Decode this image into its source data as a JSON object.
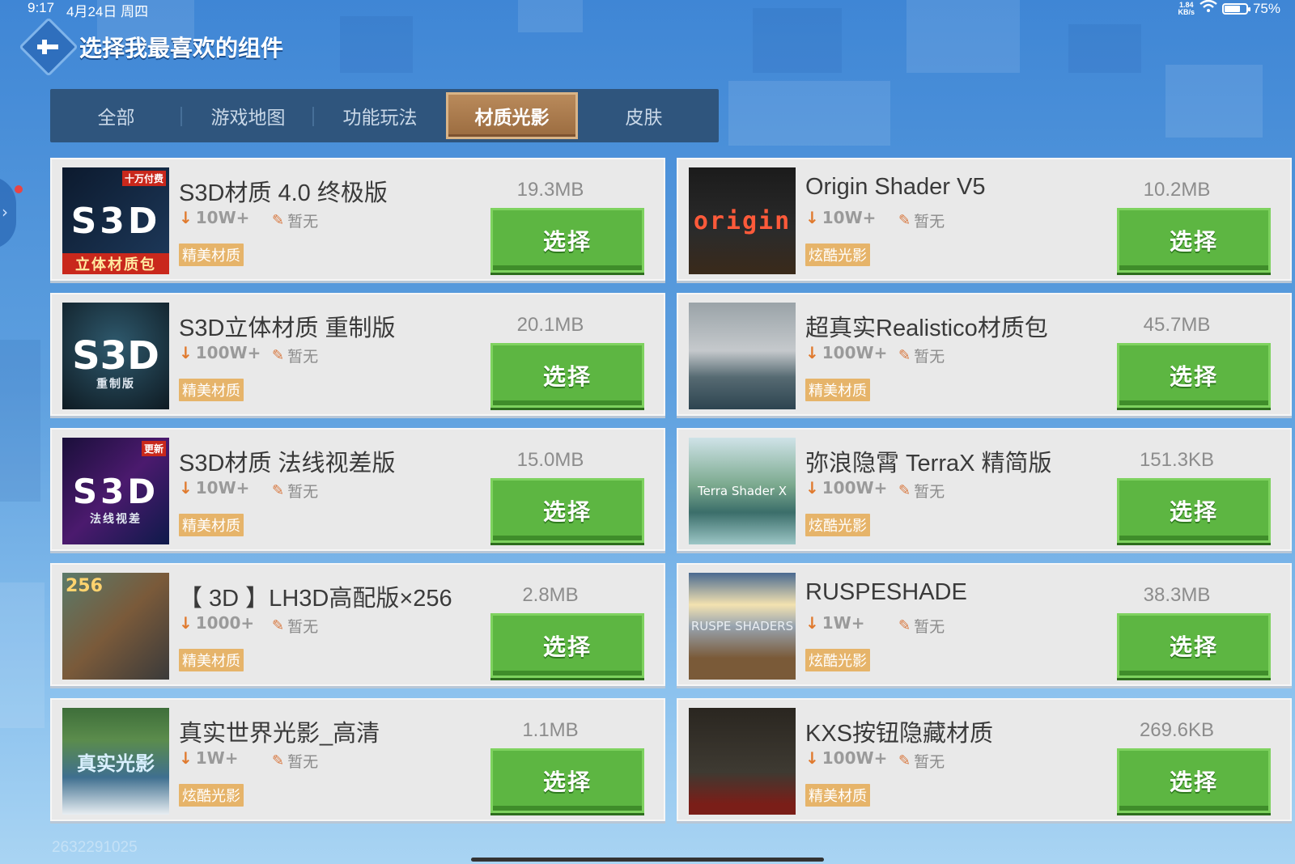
{
  "status_bar": {
    "time": "9:17",
    "date": "4月24日 周四",
    "net_speed_top": "1.84",
    "net_speed_bottom": "KB/s",
    "battery": "75%",
    "battery_level": 0.75
  },
  "header": {
    "title": "选择我最喜欢的组件"
  },
  "tabs": [
    {
      "label": "全部",
      "active": false
    },
    {
      "label": "游戏地图",
      "active": false
    },
    {
      "label": "功能玩法",
      "active": false
    },
    {
      "label": "材质光影",
      "active": true
    },
    {
      "label": "皮肤",
      "active": false
    }
  ],
  "button_label": "选择",
  "items": [
    {
      "name": "S3D材质 4.0 终极版",
      "downloads": "10W+",
      "rating": "暂无",
      "tag": "精美材质",
      "size": "19.3MB",
      "thumb_text": "S3D",
      "thumb_badge": "十万付费",
      "thumb_sub": "立体材质包"
    },
    {
      "name": "Origin Shader V5",
      "downloads": "10W+",
      "rating": "暂无",
      "tag": "炫酷光影",
      "size": "10.2MB",
      "thumb_text": "origin"
    },
    {
      "name": "S3D立体材质 重制版",
      "downloads": "100W+",
      "rating": "暂无",
      "tag": "精美材质",
      "size": "20.1MB",
      "thumb_text": "S3D",
      "thumb_sub": "重制版"
    },
    {
      "name": "超真实Realistico材质包",
      "downloads": "100W+",
      "rating": "暂无",
      "tag": "精美材质",
      "size": "45.7MB"
    },
    {
      "name": "S3D材质 法线视差版",
      "downloads": "10W+",
      "rating": "暂无",
      "tag": "精美材质",
      "size": "15.0MB",
      "thumb_text": "S3D",
      "thumb_badge": "更新",
      "thumb_sub": "法线视差"
    },
    {
      "name": "弥浪隐霄 TerraX 精简版",
      "downloads": "100W+",
      "rating": "暂无",
      "tag": "炫酷光影",
      "size": "151.3KB",
      "thumb_text": "Terra Shader X"
    },
    {
      "name": "【 3D 】LH3D高配版×256",
      "downloads": "1000+",
      "rating": "暂无",
      "tag": "精美材质",
      "size": "2.8MB",
      "thumb_text": "256"
    },
    {
      "name": "RUSPESHADE",
      "downloads": "1W+",
      "rating": "暂无",
      "tag": "炫酷光影",
      "size": "38.3MB",
      "thumb_text": "RUSPE SHADERS"
    },
    {
      "name": "真实世界光影_高清",
      "downloads": "1W+",
      "rating": "暂无",
      "tag": "炫酷光影",
      "size": "1.1MB",
      "thumb_text": "真实光影"
    },
    {
      "name": "KXS按钮隐藏材质",
      "downloads": "100W+",
      "rating": "暂无",
      "tag": "精美材质",
      "size": "269.6KB"
    }
  ],
  "watermark": "2632291025",
  "colors": {
    "accent_green": "#5db642",
    "tag_orange": "#e6b46a",
    "tab_bg": "#2f557d",
    "tab_active": "#b98a5b"
  }
}
